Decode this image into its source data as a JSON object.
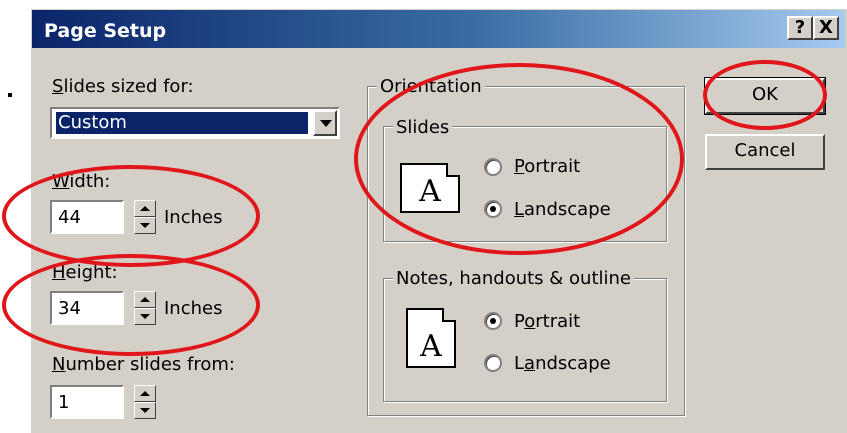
{
  "dialog": {
    "title": "Page Setup",
    "help_button": "?",
    "close_button": "X"
  },
  "slides_sized_for": {
    "label_first": "S",
    "label_rest": "lides sized for:",
    "value": "Custom"
  },
  "width": {
    "label_first": "W",
    "label_rest": "idth:",
    "value": "44",
    "unit": "Inches"
  },
  "height": {
    "label_first": "H",
    "label_rest": "eight:",
    "value": "34",
    "unit": "Inches"
  },
  "number_slides_from": {
    "label_first": "N",
    "label_rest": "umber slides from:",
    "value": "1"
  },
  "orientation": {
    "group_label": "Orientation",
    "slides": {
      "group_label": "Slides",
      "portrait_pre": "",
      "portrait_u": "P",
      "portrait_rest": "ortrait",
      "landscape_pre": "",
      "landscape_u": "L",
      "landscape_rest": "andscape",
      "selected": "Landscape"
    },
    "notes": {
      "group_label": "Notes, handouts & outline",
      "portrait_pre": "P",
      "portrait_u": "o",
      "portrait_rest": "rtrait",
      "landscape_pre": "L",
      "landscape_u": "a",
      "landscape_rest": "ndscape",
      "selected": "Portrait"
    },
    "icon_letter": "A"
  },
  "buttons": {
    "ok": "OK",
    "cancel": "Cancel"
  },
  "colors": {
    "highlight_ring": "#e0161b",
    "title_bar": "#0a246a",
    "dialog_face": "#d4d0c8"
  }
}
